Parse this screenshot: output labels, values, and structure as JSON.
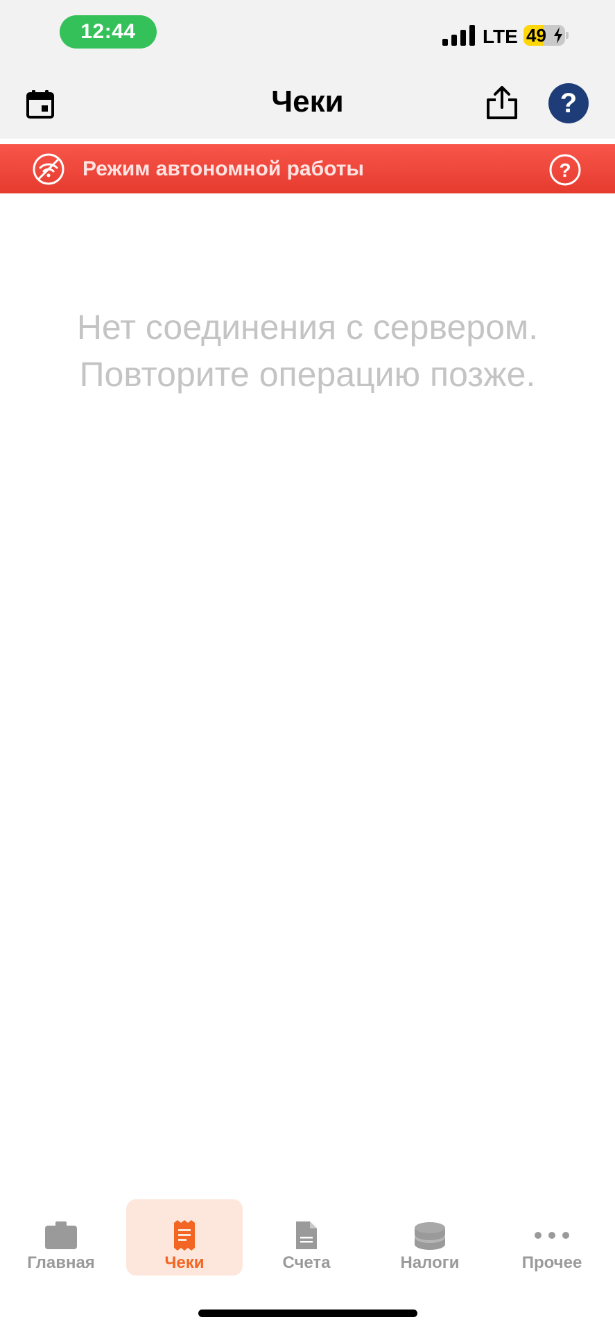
{
  "status_bar": {
    "time": "12:44",
    "network": "LTE",
    "battery_level": "49",
    "battery_percent": 49,
    "battery_color": "#ffd60a",
    "time_pill_color": "#34c15a"
  },
  "header": {
    "title": "Чеки",
    "left_icon": "calendar-icon",
    "right_icons": [
      "share-icon",
      "help-icon"
    ],
    "help_label": "?",
    "help_color": "#1e3d78"
  },
  "banner": {
    "text": "Режим автономной работы",
    "icon": "wifi-off-icon",
    "help_icon": "question-circle-icon",
    "color": "#f04438"
  },
  "empty_state": {
    "line1": "Нет соединения с сервером.",
    "line2": "Повторите операцию позже."
  },
  "tab_bar": {
    "active_color": "#f26522",
    "inactive_color": "#9a9a9a",
    "tabs": [
      {
        "label": "Главная",
        "icon": "briefcase-icon",
        "active": false
      },
      {
        "label": "Чеки",
        "icon": "receipt-icon",
        "active": true
      },
      {
        "label": "Счета",
        "icon": "document-icon",
        "active": false
      },
      {
        "label": "Налоги",
        "icon": "coins-icon",
        "active": false
      },
      {
        "label": "Прочее",
        "icon": "more-icon",
        "active": false
      }
    ]
  }
}
